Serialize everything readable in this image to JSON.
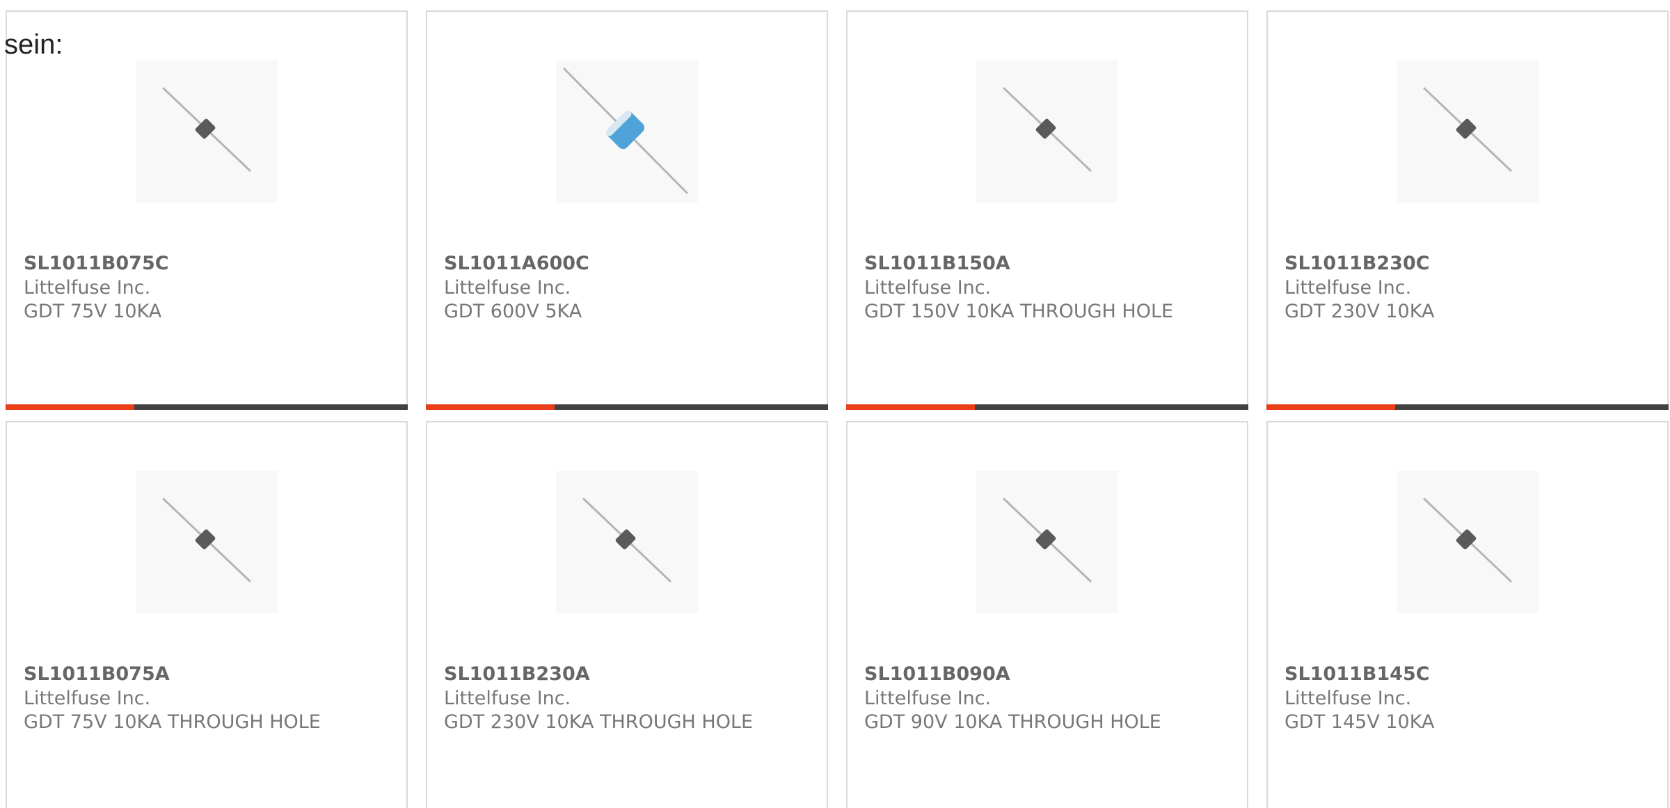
{
  "intro_text": "sein:",
  "colors": {
    "accent": "#ea3e18",
    "track": "#414141",
    "border": "#d9d9d9",
    "text": "#777777",
    "lead": "#b5b5b5",
    "gray_body": "#5a5a5a",
    "blue_body": "#4fa3d9"
  },
  "products": [
    {
      "part": "SL1011B075C",
      "manufacturer": "Littelfuse Inc.",
      "description": "GDT 75V 10KA",
      "icon": "gas-discharge-tube-icon",
      "body_color": "gray",
      "progress": 0.32
    },
    {
      "part": "SL1011A600C",
      "manufacturer": "Littelfuse Inc.",
      "description": "GDT 600V 5KA",
      "icon": "gas-discharge-tube-icon",
      "body_color": "blue",
      "progress": 0.32
    },
    {
      "part": "SL1011B150A",
      "manufacturer": "Littelfuse Inc.",
      "description": "GDT 150V 10KA THROUGH HOLE",
      "icon": "gas-discharge-tube-icon",
      "body_color": "gray",
      "progress": 0.32
    },
    {
      "part": "SL1011B230C",
      "manufacturer": "Littelfuse Inc.",
      "description": "GDT 230V 10KA",
      "icon": "gas-discharge-tube-icon",
      "body_color": "gray",
      "progress": 0.32
    },
    {
      "part": "SL1011B075A",
      "manufacturer": "Littelfuse Inc.",
      "description": "GDT 75V 10KA THROUGH HOLE",
      "icon": "gas-discharge-tube-icon",
      "body_color": "gray",
      "progress": null
    },
    {
      "part": "SL1011B230A",
      "manufacturer": "Littelfuse Inc.",
      "description": "GDT 230V 10KA THROUGH HOLE",
      "icon": "gas-discharge-tube-icon",
      "body_color": "gray",
      "progress": null
    },
    {
      "part": "SL1011B090A",
      "manufacturer": "Littelfuse Inc.",
      "description": "GDT 90V 10KA THROUGH HOLE",
      "icon": "gas-discharge-tube-icon",
      "body_color": "gray",
      "progress": null
    },
    {
      "part": "SL1011B145C",
      "manufacturer": "Littelfuse Inc.",
      "description": "GDT 145V 10KA",
      "icon": "gas-discharge-tube-icon",
      "body_color": "gray",
      "progress": null
    }
  ]
}
